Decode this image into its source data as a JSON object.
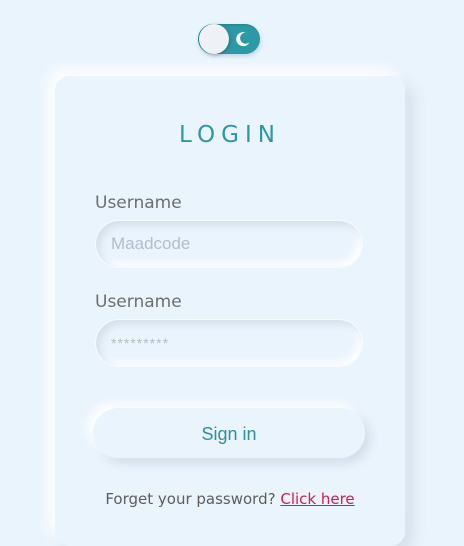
{
  "theme_toggle": {
    "icon": "moon-icon",
    "track_color": "#2b9aa6",
    "state": "on"
  },
  "login_card": {
    "title": "LOGIN",
    "username_field": {
      "label": "Username",
      "placeholder": "Maadcode",
      "value": ""
    },
    "password_field": {
      "label": "Username",
      "placeholder": "*********",
      "value": ""
    },
    "signin_button": {
      "label": "Sign in"
    },
    "forgot": {
      "text": "Forget your password?",
      "link_label": "Click here",
      "link_color": "#d9194f"
    }
  },
  "colors": {
    "background": "#eaf4fd",
    "accent": "#2e97a6"
  }
}
